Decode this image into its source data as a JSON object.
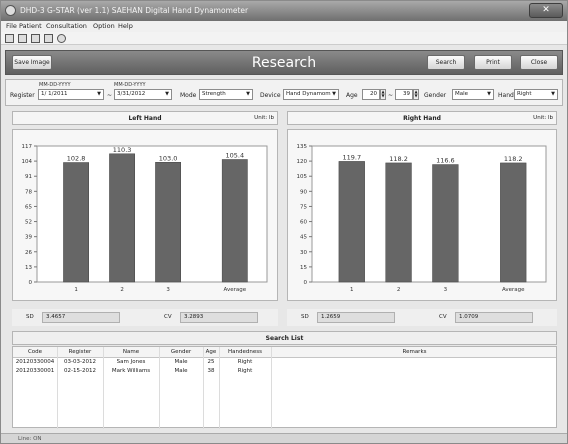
{
  "window": {
    "title": "DHD-3 G-STAR (ver 1.1) SAEHAN Digital Hand Dynamometer",
    "close_label": "✕"
  },
  "menu": [
    "File",
    "Patient",
    "Consultation",
    "Option",
    "Help"
  ],
  "toolbar_icons": [
    "new-icon",
    "open-icon",
    "save-icon",
    "delete-icon",
    "tools-icon"
  ],
  "header": {
    "title": "Research",
    "save_image": "Save Image",
    "search": "Search",
    "print": "Print",
    "close": "Close"
  },
  "filter": {
    "date_format_1": "MM-DD-YYYY",
    "date_format_2": "MM-DD-YYYY",
    "register_label": "Register",
    "date_from": "1/ 1/2011",
    "tilde": "~",
    "date_to": "3/31/2012",
    "mode_label": "Mode",
    "mode_value": "Strength",
    "device_label": "Device",
    "device_value": "Hand Dynamom",
    "age_label": "Age",
    "age_from": "20",
    "age_sep": "~",
    "age_to": "39",
    "gender_label": "Gender",
    "gender_value": "Male",
    "hand_label": "Hand",
    "hand_value": "Right"
  },
  "panels": {
    "left": {
      "title": "Left Hand",
      "unit": "Unit: lb"
    },
    "right": {
      "title": "Right Hand",
      "unit": "Unit: lb"
    }
  },
  "chart_data": [
    {
      "type": "bar",
      "categories": [
        "1",
        "2",
        "3",
        "Average"
      ],
      "values": [
        102.8,
        110.3,
        103.0,
        105.4
      ],
      "data_labels": [
        "102.8",
        "110.3",
        "103.0",
        "105.4"
      ],
      "yticks": [
        0,
        13,
        26,
        39,
        52,
        65,
        78,
        91,
        104,
        117
      ],
      "ylim": [
        0,
        117
      ],
      "bar_color": "#666666"
    },
    {
      "type": "bar",
      "categories": [
        "1",
        "2",
        "3",
        "Average"
      ],
      "values": [
        119.7,
        118.2,
        116.6,
        118.2
      ],
      "data_labels": [
        "119.7",
        "118.2",
        "116.6",
        "118.2"
      ],
      "yticks": [
        0,
        15,
        30,
        45,
        60,
        75,
        90,
        105,
        120,
        135
      ],
      "ylim": [
        0,
        135
      ],
      "bar_color": "#666666"
    }
  ],
  "stats": {
    "left": {
      "sd_label": "SD",
      "sd": "3.4657",
      "cv_label": "CV",
      "cv": "3.2893"
    },
    "right": {
      "sd_label": "SD",
      "sd": "1.2659",
      "cv_label": "CV",
      "cv": "1.0709"
    }
  },
  "search_list": {
    "title": "Search List",
    "columns": [
      "Code",
      "Register",
      "Name",
      "Gender",
      "Age",
      "Handedness",
      "Remarks"
    ],
    "rows": [
      [
        "20120330004",
        "03-03-2012",
        "Sam Jones",
        "Male",
        "25",
        "Right",
        ""
      ],
      [
        "20120330001",
        "02-15-2012",
        "Mark Williams",
        "Male",
        "38",
        "Right",
        ""
      ]
    ]
  },
  "status": "Line: ON"
}
